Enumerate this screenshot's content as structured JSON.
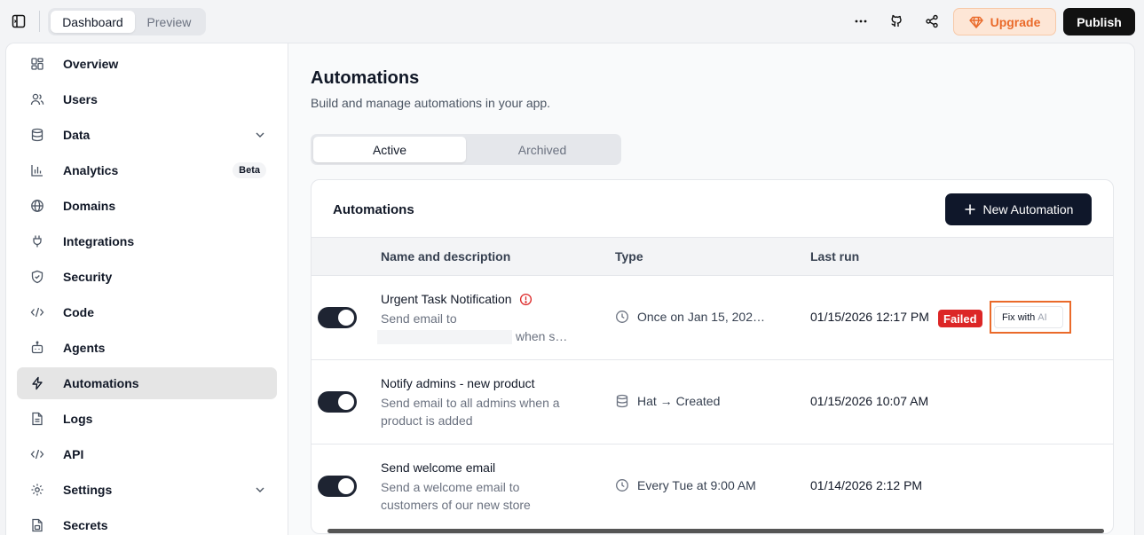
{
  "topbar": {
    "mode_tabs": [
      "Dashboard",
      "Preview"
    ],
    "upgrade_label": "Upgrade",
    "publish_label": "Publish"
  },
  "sidebar": {
    "items": [
      {
        "label": "Overview",
        "icon": "grid-icon"
      },
      {
        "label": "Users",
        "icon": "users-icon"
      },
      {
        "label": "Data",
        "icon": "database-icon",
        "expandable": true
      },
      {
        "label": "Analytics",
        "icon": "bar-chart-icon",
        "badge": "Beta"
      },
      {
        "label": "Domains",
        "icon": "globe-icon"
      },
      {
        "label": "Integrations",
        "icon": "plug-icon"
      },
      {
        "label": "Security",
        "icon": "shield-icon"
      },
      {
        "label": "Code",
        "icon": "code-icon"
      },
      {
        "label": "Agents",
        "icon": "bot-icon"
      },
      {
        "label": "Automations",
        "icon": "lightning-icon",
        "active": true
      },
      {
        "label": "Logs",
        "icon": "file-text-icon"
      },
      {
        "label": "API",
        "icon": "code-icon"
      },
      {
        "label": "Settings",
        "icon": "gear-icon",
        "expandable": true
      },
      {
        "label": "Secrets",
        "icon": "file-lock-icon"
      }
    ]
  },
  "main": {
    "title": "Automations",
    "subtitle": "Build and manage automations in your app.",
    "tabs": [
      {
        "label": "Active",
        "active": true
      },
      {
        "label": "Archived",
        "active": false
      }
    ],
    "card": {
      "title": "Automations",
      "new_button": "New Automation",
      "columns": [
        "Name and description",
        "Type",
        "Last run"
      ],
      "rows": [
        {
          "enabled": true,
          "name": "Urgent Task Notification",
          "has_warning": true,
          "desc_1": "Send email to",
          "desc_2": "when s…",
          "type": "Once on Jan 15, 202…",
          "type_icon": "clock-icon",
          "last_run": "01/15/2026 12:17 PM",
          "status": "Failed",
          "fix_label_1": "Fix with",
          "fix_label_2": "AI"
        },
        {
          "enabled": true,
          "name": "Notify admins - new product",
          "desc_1": "Send email to all admins when a",
          "desc_2": "product is added",
          "type": "Hat → Created",
          "type_icon": "database-icon",
          "last_run": "01/15/2026 10:07 AM"
        },
        {
          "enabled": true,
          "name": "Send welcome email",
          "desc_1": "Send a welcome email to",
          "desc_2": "customers of our new store",
          "type": "Every Tue at 9:00 AM",
          "type_icon": "clock-icon",
          "last_run": "01/14/2026 2:12 PM"
        }
      ]
    }
  },
  "colors": {
    "accent": "#ea6a2a",
    "failed": "#dc2626",
    "primary_button": "#0f172a"
  }
}
